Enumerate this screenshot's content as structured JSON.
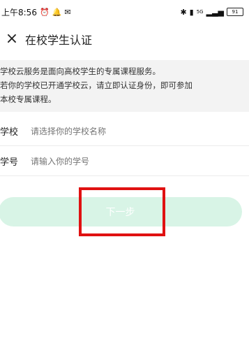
{
  "status_bar": {
    "time": "上午8:56",
    "signal_text": "5G",
    "battery_level": "91"
  },
  "header": {
    "title": "在校学生认证"
  },
  "notice": {
    "line1": "学校云服务是面向高校学生的专属课程服务。",
    "line2": "若你的学校已开通学校云，请立即认证身份，即可参加",
    "line3": "本校专属课程。"
  },
  "form": {
    "school_label": "学校",
    "school_placeholder": "请选择你的学校名称",
    "student_id_label": "学号",
    "student_id_placeholder": "请输入你的学号"
  },
  "actions": {
    "next_label": "下一步"
  },
  "colors": {
    "button_bg": "#d8f4e6",
    "highlight": "#e01111",
    "notice_bg": "#f3f3f3"
  },
  "icons": {
    "close": "close-icon",
    "alarm": "alarm-icon",
    "bluetooth": "bluetooth-icon",
    "signal": "signal-icon",
    "battery": "battery-icon"
  }
}
